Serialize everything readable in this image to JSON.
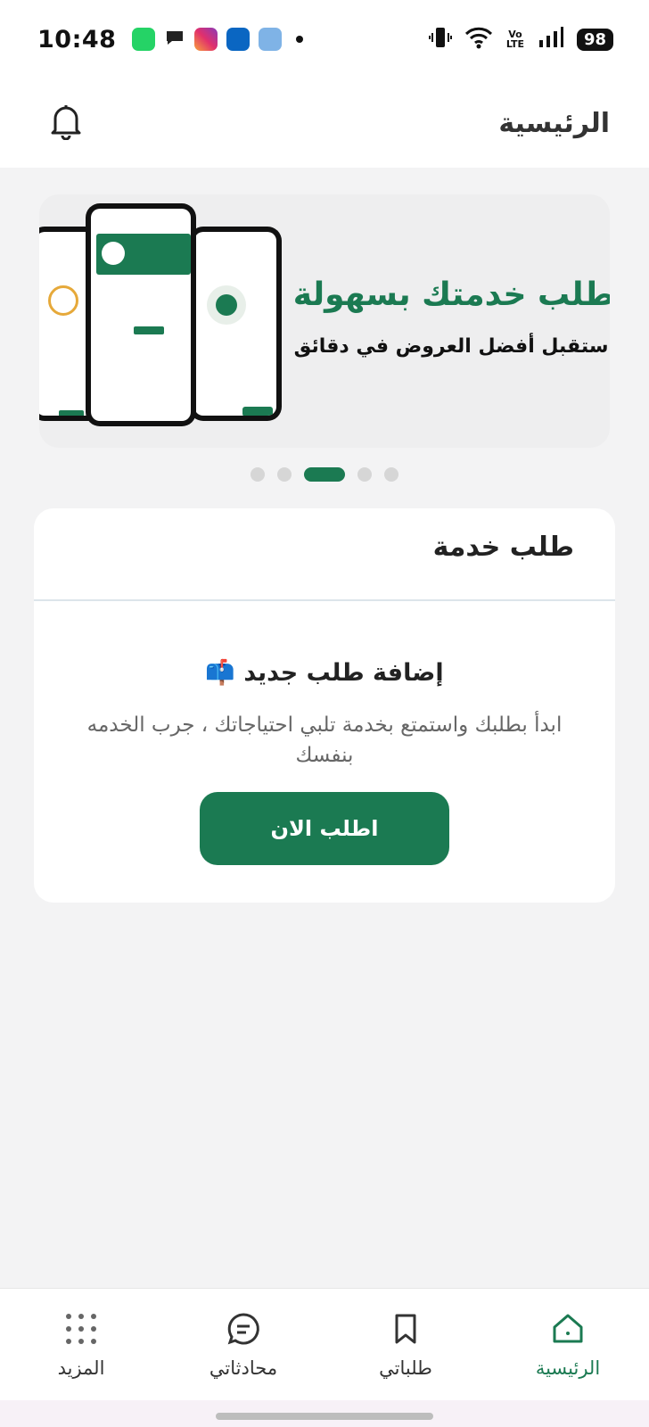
{
  "status_bar": {
    "time": "10:48",
    "notification_icons": [
      {
        "name": "whatsapp-icon",
        "color": "#25d366"
      },
      {
        "name": "messages-icon",
        "color": "#222222"
      },
      {
        "name": "instagram-icon",
        "color": "#e1306c"
      },
      {
        "name": "linkedin-icon",
        "color": "#0a66c2"
      },
      {
        "name": "weather-icon",
        "color": "#7fb3e6"
      }
    ],
    "volte": "Vo LTE",
    "battery": "98"
  },
  "header": {
    "title": "الرئيسية"
  },
  "banner": {
    "headline": "اطلب خدمتك بسهولة",
    "subline": "استقبل أفضل العروض في دقائق",
    "slide_count": 5,
    "active_slide": 3
  },
  "service_card": {
    "title": "طلب خدمة",
    "add_title": "إضافة طلب جديد 📫",
    "description": "ابدأ بطلبك واستمتع بخدمة تلبي احتياجاتك ، جرب الخدمه بنفسك",
    "button_label": "اطلب الان"
  },
  "bottom_nav": {
    "items": [
      {
        "label": "الرئيسية",
        "icon": "home-icon",
        "active": true
      },
      {
        "label": "طلباتي",
        "icon": "bookmark-icon",
        "active": false
      },
      {
        "label": "محادثاتي",
        "icon": "chat-icon",
        "active": false
      },
      {
        "label": "المزيد",
        "icon": "grid-dots-icon",
        "active": false
      }
    ]
  },
  "colors": {
    "brand": "#1b7a52",
    "background": "#f3f3f4"
  }
}
